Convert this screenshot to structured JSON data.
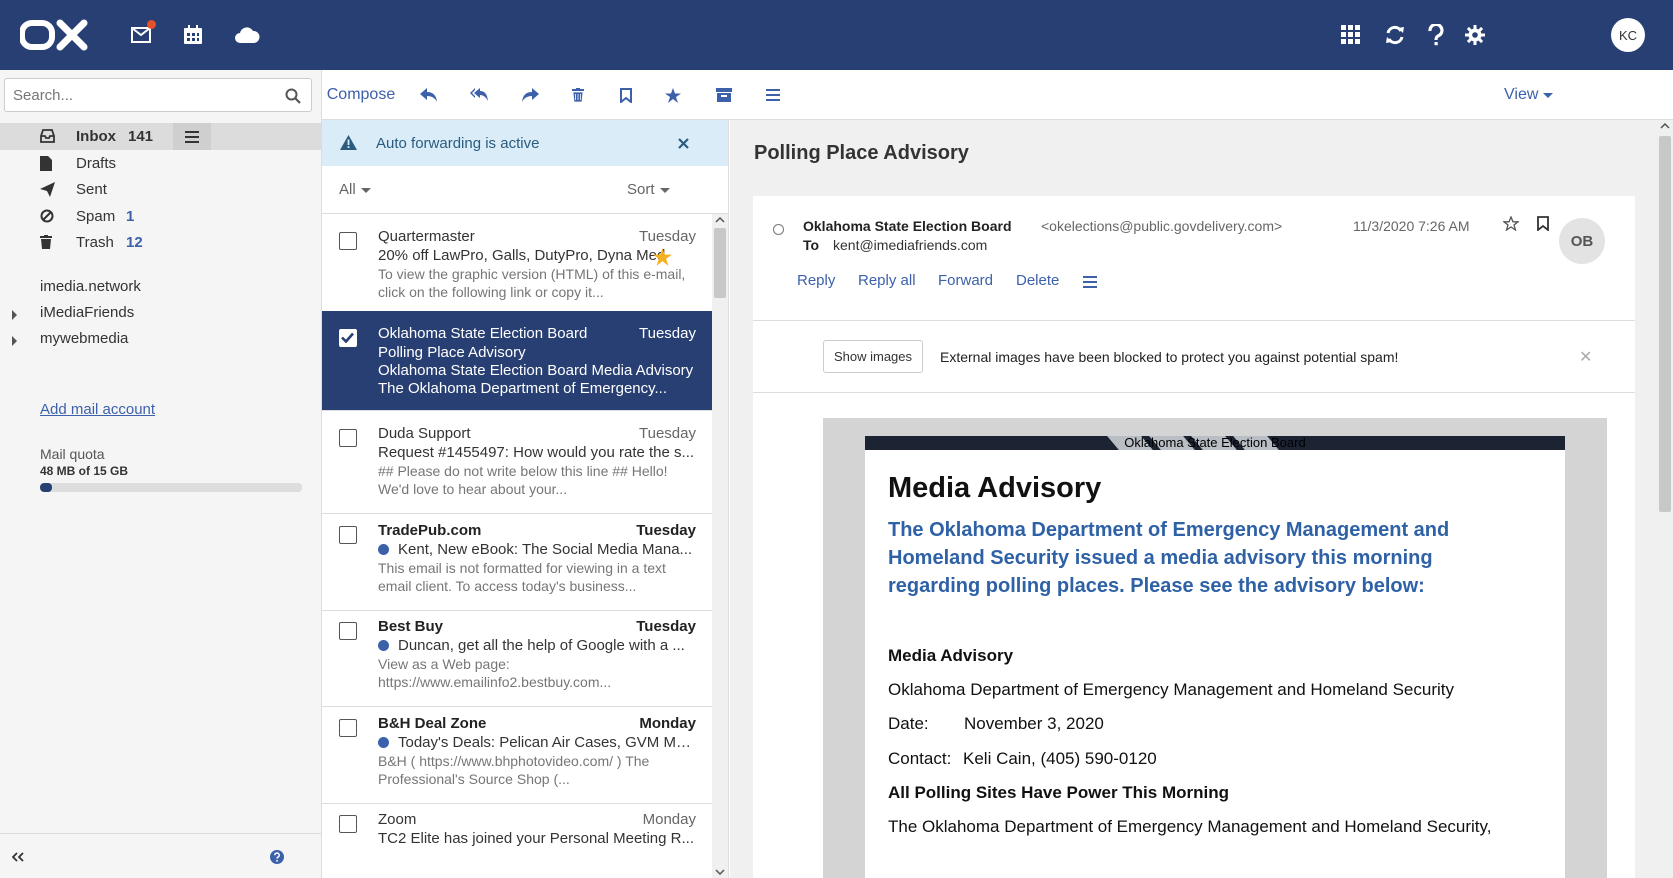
{
  "topbar": {
    "logo": "OX",
    "avatar_initials": "KC",
    "icons": [
      "mail-icon",
      "calendar-icon",
      "cloud-icon",
      "apps-grid-icon",
      "refresh-icon",
      "help-icon",
      "settings-icon"
    ],
    "colors": {
      "bar": "#283f73",
      "accent": "#3c61aa",
      "badge": "#e6502b"
    }
  },
  "search": {
    "placeholder": "Search..."
  },
  "folders": [
    {
      "label": "Inbox",
      "count": "141",
      "icon": "inbox-icon"
    },
    {
      "label": "Drafts",
      "count": "",
      "icon": "file-icon"
    },
    {
      "label": "Sent",
      "count": "",
      "icon": "paper-plane-icon"
    },
    {
      "label": "Spam",
      "count": "1",
      "icon": "ban-icon"
    },
    {
      "label": "Trash",
      "count": "12",
      "icon": "trash-icon"
    }
  ],
  "accounts": [
    "imedia.network",
    "iMediaFriends",
    "mywebmedia"
  ],
  "add_account": "Add mail account",
  "quota": {
    "label": "Mail quota",
    "value": "48 MB of 15 GB",
    "fraction": 0.003
  },
  "toolbar": {
    "compose": "Compose",
    "view": "View"
  },
  "notice": {
    "text": "Auto forwarding is active"
  },
  "list": {
    "filter": "All",
    "sort": "Sort",
    "items": [
      {
        "from": "Quartermaster",
        "date": "Tuesday",
        "subject": "20% off LawPro, Galls, DutyPro, Dyna Med",
        "preview": "To view the graphic version (HTML) of this e-mail, click on the following link or copy it..."
      },
      {
        "from": "Oklahoma State Election Board",
        "date": "Tuesday",
        "subject": "Polling Place Advisory",
        "preview": "Oklahoma State Election Board Media Advisory The Oklahoma Department of Emergency..."
      },
      {
        "from": "Duda Support",
        "date": "Tuesday",
        "subject": "Request #1455497: How would you rate the s...",
        "preview": "## Please do not write below this line ## Hello! We'd love to hear about your..."
      },
      {
        "from": "TradePub.com",
        "date": "Tuesday",
        "subject": "Kent, New eBook: The Social Media Mana...",
        "preview": "This email is not formatted for viewing in a text email client. To access today's business..."
      },
      {
        "from": "Best Buy",
        "date": "Tuesday",
        "subject": "Duncan, get all the help of Google with a ...",
        "preview": "View as a Web page: https://www.emailinfo2.bestbuy.com..."
      },
      {
        "from": "B&H Deal Zone",
        "date": "Monday",
        "subject": "Today's Deals: Pelican Air Cases, GVM Mot...",
        "preview": "B&H ( https://www.bhphotovideo.com/ ) The Professional's Source Shop (..."
      },
      {
        "from": "Zoom",
        "date": "Monday",
        "subject": "TC2 Elite has joined your Personal Meeting R...",
        "preview": ""
      }
    ]
  },
  "reader": {
    "subject": "Polling Place Advisory",
    "from_name": "Oklahoma State Election Board",
    "from_email": "<okelections@public.govdelivery.com>",
    "to_label": "To",
    "to": "kent@imediafriends.com",
    "date": "11/3/2020 7:26 AM",
    "avatar": "OB",
    "actions": {
      "reply": "Reply",
      "reply_all": "Reply all",
      "forward": "Forward",
      "delete": "Delete"
    },
    "show_images": "Show images",
    "images_blocked": "External images have been blocked to protect you against potential spam!",
    "body": {
      "banner": "Oklahoma State Election Board",
      "heading": "Media Advisory",
      "lead": "The Oklahoma Department of Emergency Management and Homeland Security issued a media advisory this morning regarding polling places. Please see the advisory below:",
      "subheading": "Media Advisory",
      "org": "Oklahoma Department of Emergency Management and Homeland Security",
      "date_label": "Date:",
      "date_value": "November 3, 2020",
      "contact_label": "Contact:",
      "contact_value": "Keli Cain, (405) 590-0120",
      "headline": "All Polling Sites Have Power This Morning",
      "paragraph": "The Oklahoma Department of Emergency Management and Homeland Security,"
    }
  }
}
